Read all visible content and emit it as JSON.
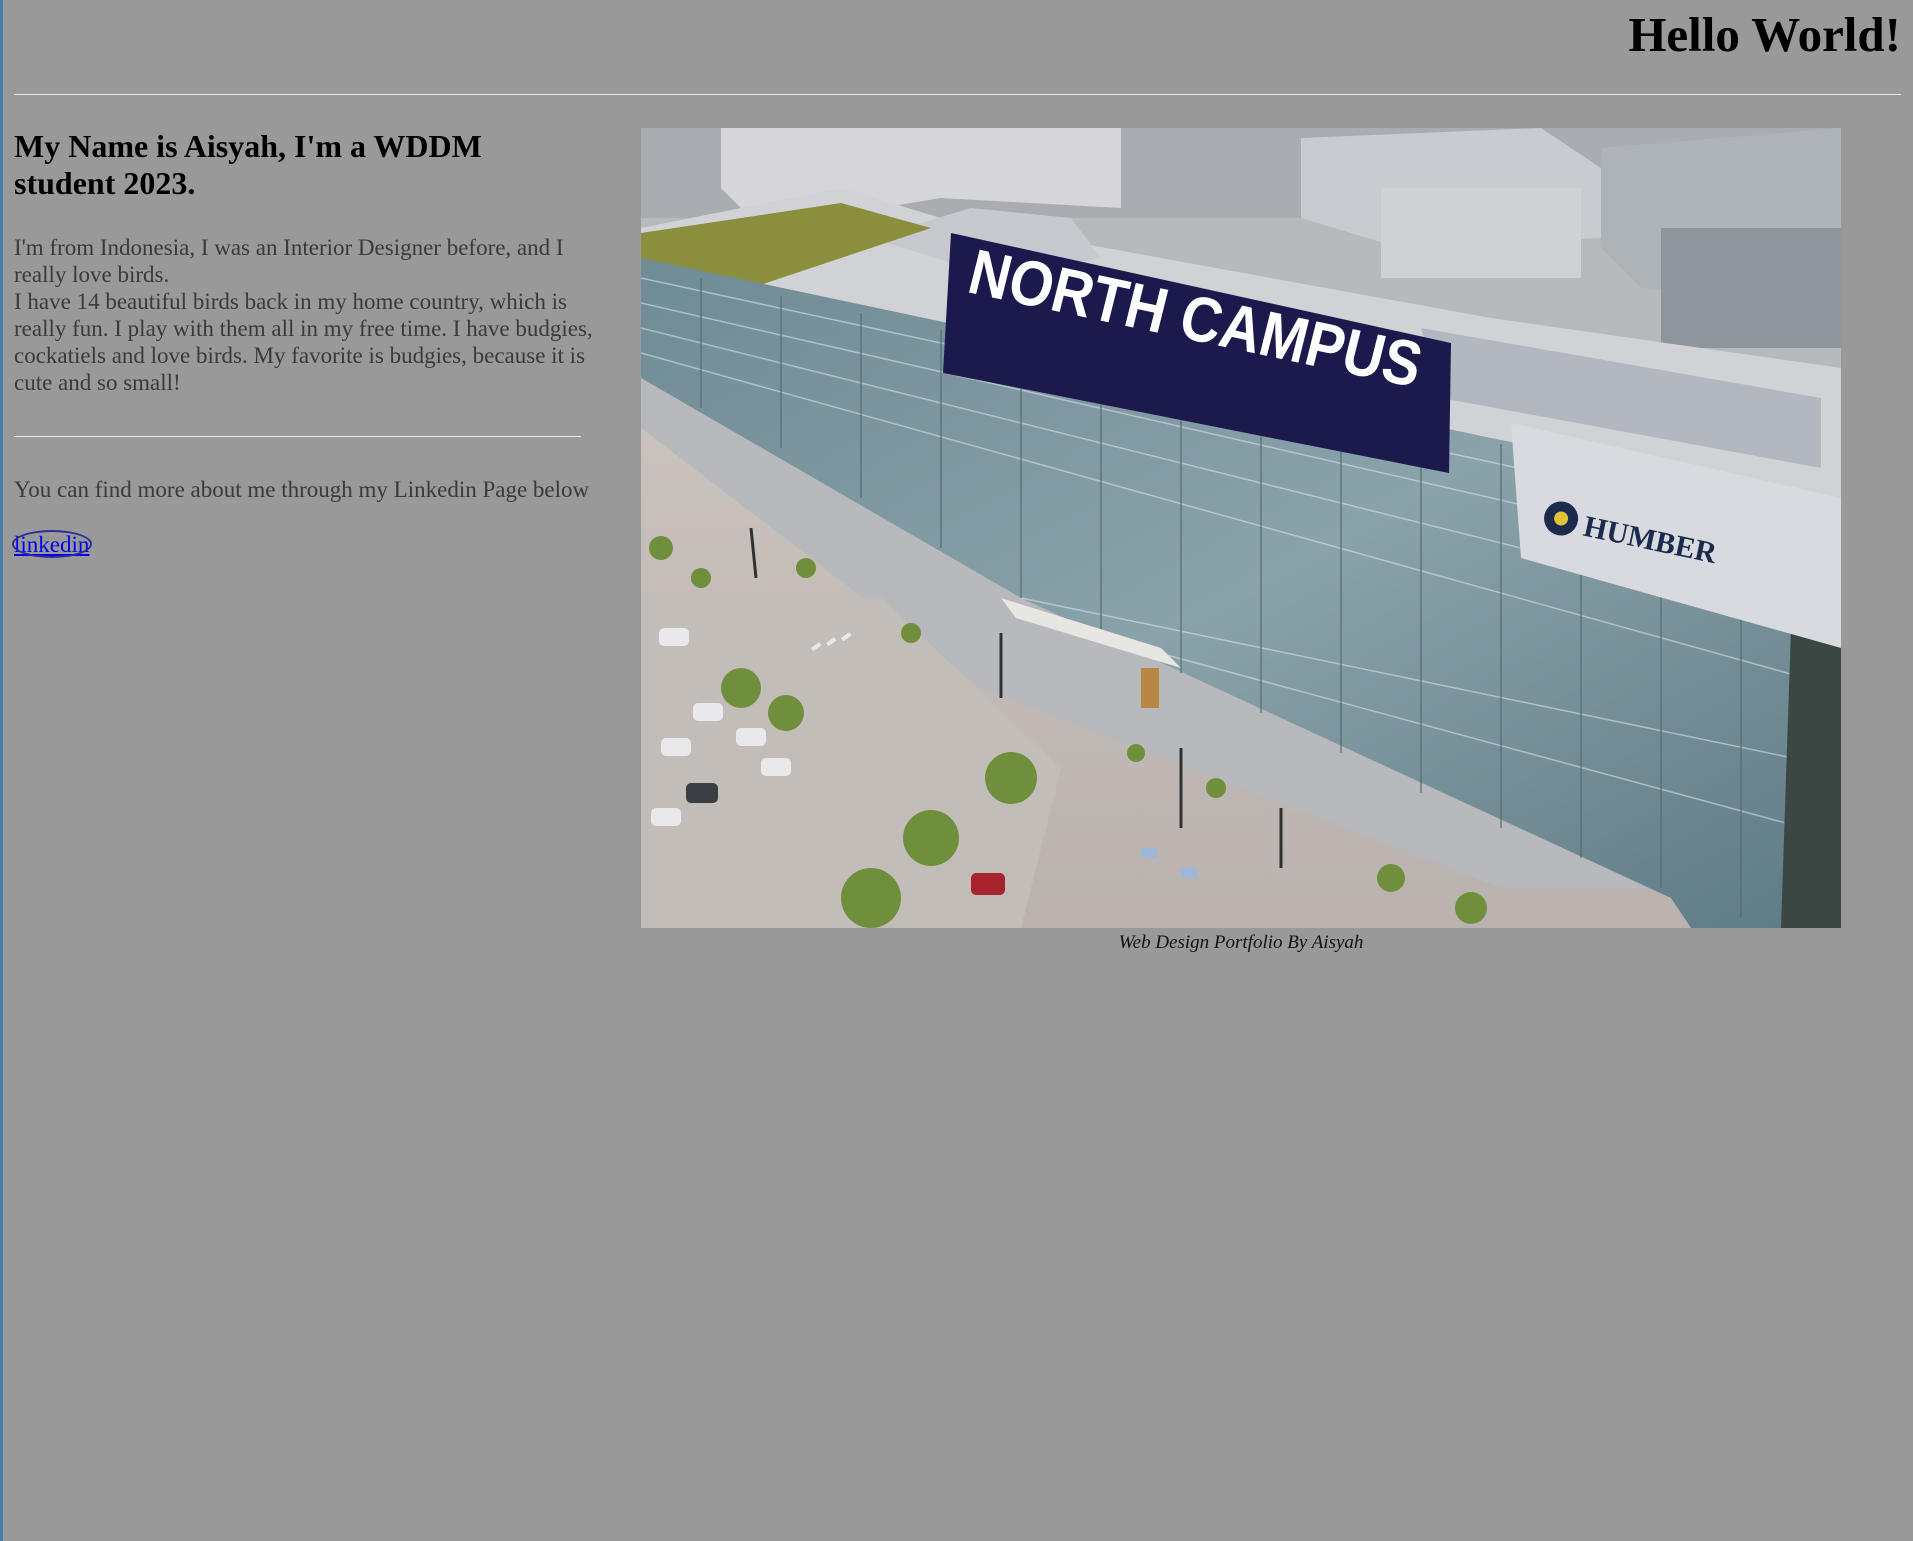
{
  "header": {
    "title": "Hello World!"
  },
  "intro": {
    "heading": "My Name is Aisyah, I'm a WDDM student 2023.",
    "bio_line1": "I'm from Indonesia, I was an Interior Designer before, and I really love birds.",
    "bio_line2": "I have 14 beautiful birds back in my home country, which is really fun. I play with them all in my free time. I have budgies, cockatiels and love birds. My favorite is budgies, because it is cute and so small!"
  },
  "contact": {
    "text": "You can find more about me through my Linkedin Page below",
    "link_label": "linkedin"
  },
  "photo": {
    "banner_text": "NORTH CAMPUS",
    "logo_text": "HUMBER",
    "caption": "Web Design Portfolio By Aisyah"
  },
  "colors": {
    "page_background": "#999999",
    "banner": "#1c1a4d",
    "link": "#0000ee"
  }
}
